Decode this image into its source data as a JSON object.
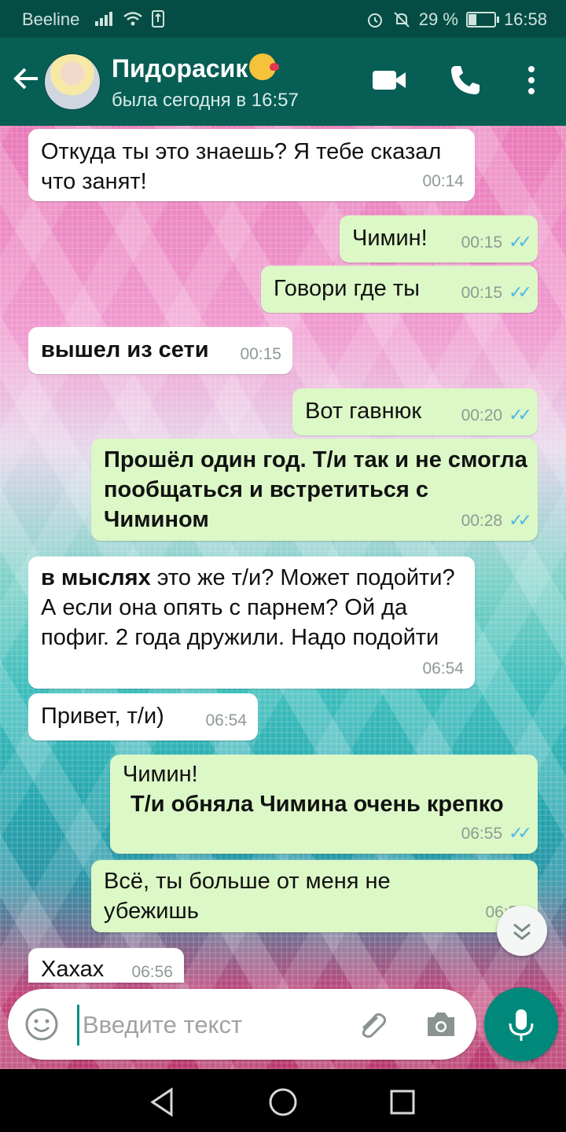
{
  "status_bar": {
    "carrier": "Beeline",
    "battery": "29 %",
    "battery_level": 0.29,
    "time": "16:58"
  },
  "header": {
    "contact_name": "Пидорасик",
    "contact_status": "была сегодня в 16:57"
  },
  "messages": [
    {
      "text": "Откуда ты это знаешь? Я тебе сказал что занят!",
      "time": "00:14"
    },
    {
      "text": "Чимин!",
      "time": "00:15"
    },
    {
      "text": "Говори где ты",
      "time": "00:15"
    },
    {
      "text": "вышел из сети",
      "time": "00:15"
    },
    {
      "text": "Вот гавнюк",
      "time": "00:20"
    },
    {
      "text": "Прошёл один год. Т/и так и не смогла пообщаться и встретиться с Чимином",
      "time": "00:28"
    },
    {
      "bold": "в мыслях",
      "text": " это же т/и? Может подойти? А если она опять с парнем? Ой да пофиг. 2 года дружили. Надо подойти",
      "time": "06:54"
    },
    {
      "text": "Привет, т/и)",
      "time": "06:54"
    },
    {
      "line1": "Чимин!",
      "line2": "Т/и обняла Чимина очень крепко",
      "time": "06:55"
    },
    {
      "text": "Всё, ты больше от меня не убежишь",
      "time": "06:56"
    },
    {
      "text": "Хахах",
      "time": "06:56"
    }
  ],
  "input": {
    "placeholder": "Введите текст"
  },
  "colors": {
    "header": "#075e54",
    "status_bar": "#054d44",
    "incoming_bubble": "#ffffff",
    "outgoing_bubble": "#dcf8c6",
    "read_ticks": "#4fb6ec",
    "mic_button": "#00897b"
  },
  "icons": [
    "back-arrow-icon",
    "video-call-icon",
    "phone-icon",
    "more-vert-icon",
    "emoji-icon",
    "attach-icon",
    "camera-icon",
    "mic-icon",
    "chevron-down-icon",
    "nav-back-icon",
    "nav-home-icon",
    "nav-recents-icon"
  ]
}
